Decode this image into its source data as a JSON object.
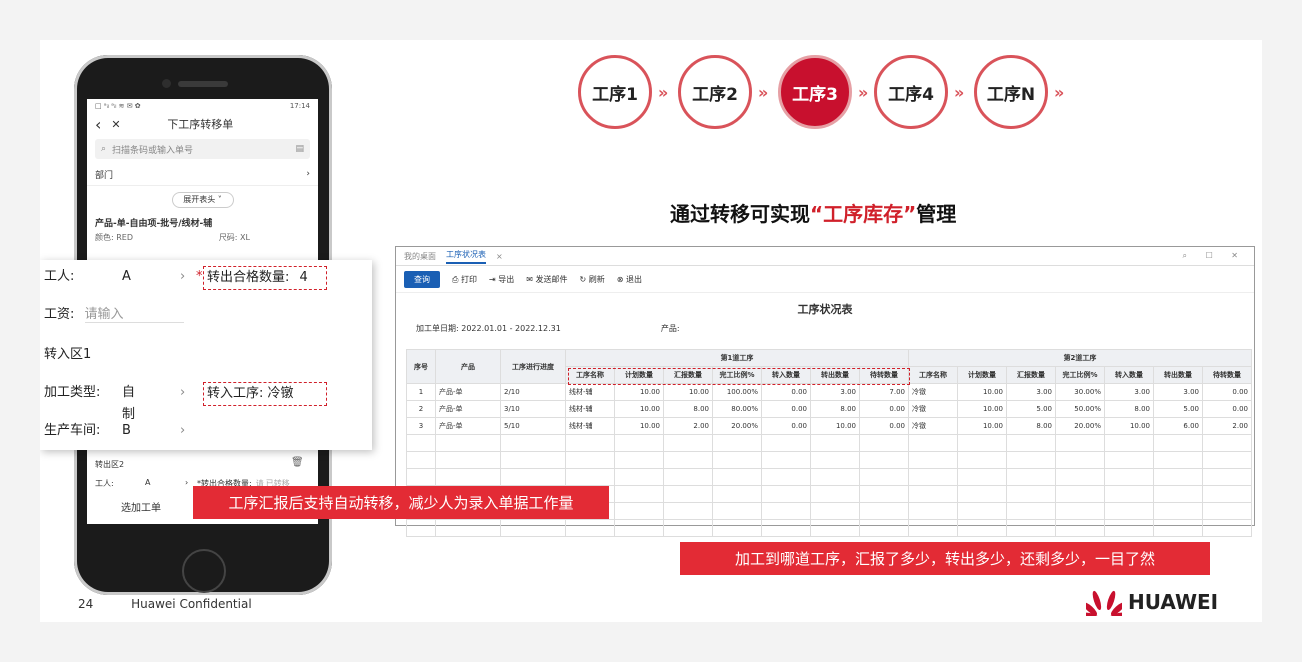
{
  "steps": [
    {
      "label": "工序1"
    },
    {
      "label": "工序2"
    },
    {
      "label": "工序3"
    },
    {
      "label": "工序4"
    },
    {
      "label": "工序N"
    }
  ],
  "headline": {
    "pre": "通过转移可实现",
    "highlight": "“工序库存”",
    "post": "管理"
  },
  "phone": {
    "status_left": "□ ᵃᵢₗ ᵃᵢₗ ≋ ✉ ✿",
    "status_right": "17:14",
    "back": "‹",
    "close": "✕",
    "title": "下工序转移单",
    "search_placeholder": "扫描条码或输入单号",
    "dept_label": "部门",
    "expand_label": "展开表头 ˅",
    "product_title": "产品-单-自由项-批号/线材-辅",
    "color": "颜色: RED",
    "size": "尺码: XL",
    "out_area": "转出区2",
    "worker_label": "工人:",
    "worker_value": "A",
    "qual_label": "*转出合格数量:",
    "qual_hint": "请",
    "transfer_hint": "已转移",
    "add_label": "选加工单"
  },
  "overlay": {
    "worker_label": "工人:",
    "worker_value": "A",
    "qual_label": "转出合格数量:",
    "qual_value": "4",
    "wage_label": "工资:",
    "wage_placeholder": "请输入",
    "in_area": "转入区1",
    "type_label": "加工类型:",
    "type_value": "自制",
    "into_label": "转入工序:",
    "into_value": "冷镦",
    "workshop_label": "生产车间:",
    "workshop_value": "B"
  },
  "window": {
    "tab_home": "我的桌面",
    "tab_active": "工序状况表",
    "query": "查询",
    "print": "打印",
    "export": "导出",
    "mail": "发送邮件",
    "refresh": "刷新",
    "exit": "退出",
    "report_title": "工序状况表",
    "date_label": "加工单日期:",
    "date_value": "2022.01.01 - 2022.12.31",
    "product_label": "产品:",
    "h_no": "序号",
    "h_product": "产品",
    "h_progress": "工序进行进度",
    "h_group1": "第1道工序",
    "h_group2": "第2道工序",
    "sub": [
      "工序名称",
      "计划数量",
      "汇报数量",
      "完工比例%",
      "转入数量",
      "转出数量",
      "待转数量"
    ],
    "rows": [
      {
        "no": "1",
        "product": "产品-单",
        "progress": "2/10",
        "p1": [
          "线材-辅",
          "10.00",
          "10.00",
          "100.00%",
          "0.00",
          "3.00",
          "7.00"
        ],
        "p2": [
          "冷镦",
          "10.00",
          "3.00",
          "30.00%",
          "3.00",
          "3.00",
          "0.00"
        ]
      },
      {
        "no": "2",
        "product": "产品-单",
        "progress": "3/10",
        "p1": [
          "线材-辅",
          "10.00",
          "8.00",
          "80.00%",
          "0.00",
          "8.00",
          "0.00"
        ],
        "p2": [
          "冷镦",
          "10.00",
          "5.00",
          "50.00%",
          "8.00",
          "5.00",
          "0.00"
        ]
      },
      {
        "no": "3",
        "product": "产品-单",
        "progress": "5/10",
        "p1": [
          "线材-辅",
          "10.00",
          "2.00",
          "20.00%",
          "0.00",
          "10.00",
          "0.00"
        ],
        "p2": [
          "冷镦",
          "10.00",
          "8.00",
          "20.00%",
          "10.00",
          "6.00",
          "2.00"
        ]
      }
    ]
  },
  "callout_left": "工序汇报后支持自动转移，减少人为录入单据工作量",
  "callout_right": "加工到哪道工序，汇报了多少，转出多少，还剩多少，一目了然",
  "footer": {
    "page": "24",
    "conf": "Huawei Confidential"
  },
  "brand": "HUAWEI",
  "colors": {
    "accent": "#c8102e",
    "callout": "#e32b35",
    "link": "#1a5fb4"
  }
}
